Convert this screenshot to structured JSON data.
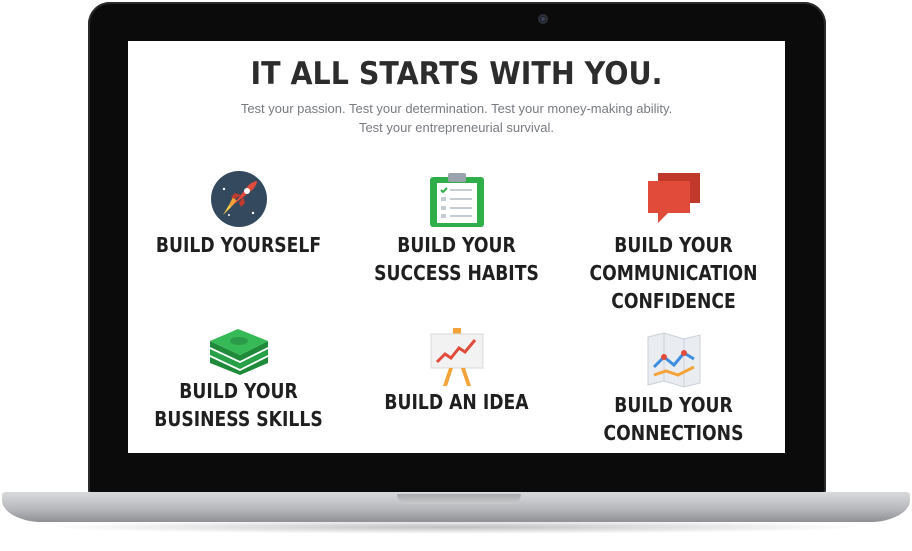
{
  "hero": {
    "title": "IT ALL STARTS WITH YOU.",
    "subtitle_line1": "Test your passion. Test your determination. Test your money-making ability.",
    "subtitle_line2": "Test your entrepreneurial survival."
  },
  "features": [
    {
      "label": "BUILD YOURSELF",
      "icon": "rocket-icon"
    },
    {
      "label": "BUILD YOUR SUCCESS HABITS",
      "icon": "clipboard-checklist-icon"
    },
    {
      "label": "BUILD YOUR COMMUNICATION CONFIDENCE",
      "icon": "chat-bubbles-icon"
    },
    {
      "label": "BUILD YOUR BUSINESS SKILLS",
      "icon": "money-stack-icon"
    },
    {
      "label": "BUILD AN IDEA",
      "icon": "growth-chart-easel-icon"
    },
    {
      "label": "BUILD YOUR CONNECTIONS",
      "icon": "map-route-icon"
    }
  ],
  "colors": {
    "text_dark": "#1f1f1f",
    "text_muted": "#777b80",
    "red": "#e04b3a",
    "green": "#2fae4a",
    "navy": "#34485e"
  }
}
